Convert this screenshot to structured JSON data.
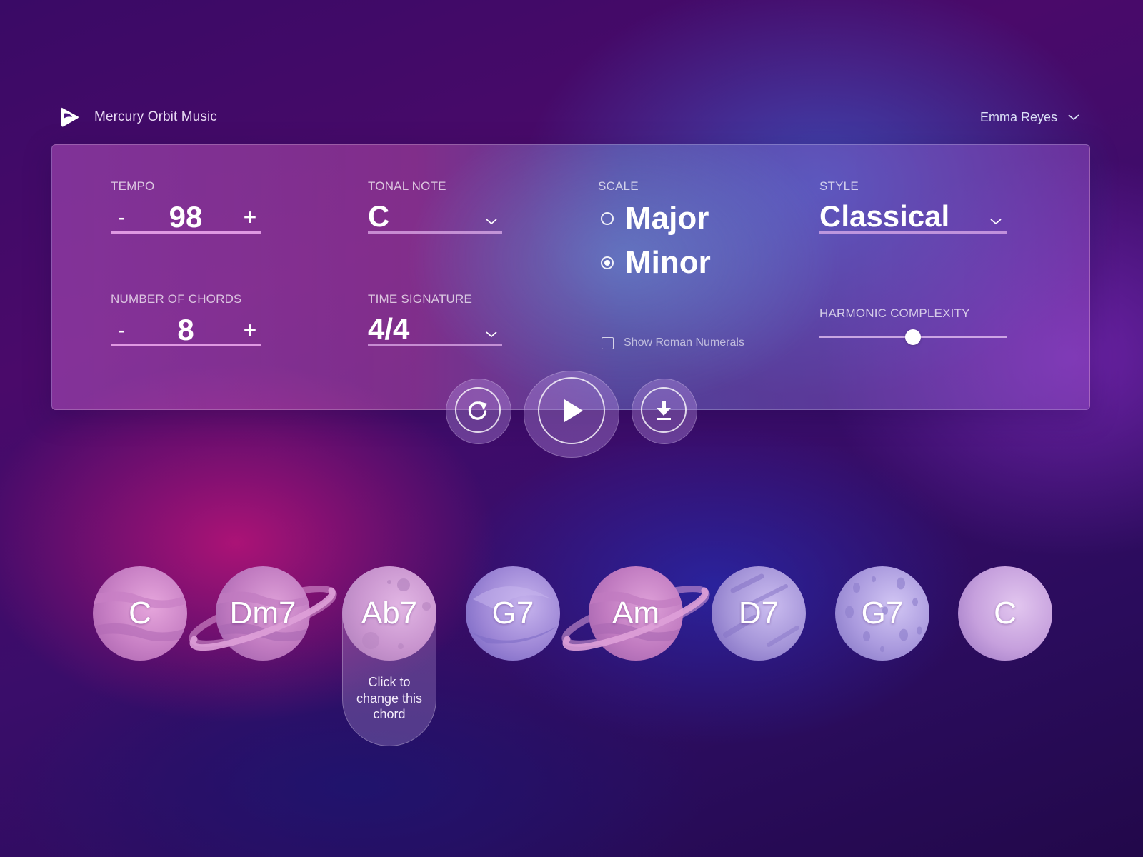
{
  "app": {
    "name": "Mercury Orbit Music",
    "logo_icon": "play-orbit-logo-icon"
  },
  "user": {
    "name": "Emma Reyes",
    "menu_icon": "chevron-down-icon"
  },
  "controls": {
    "tempo": {
      "label": "TEMPO",
      "value": "98",
      "decrement": "-",
      "increment": "+"
    },
    "chords_count": {
      "label": "NUMBER OF CHORDS",
      "value": "8",
      "decrement": "-",
      "increment": "+"
    },
    "tonal_note": {
      "label": "TONAL NOTE",
      "value": "C"
    },
    "time_signature": {
      "label": "TIME SIGNATURE",
      "value": "4/4"
    },
    "scale": {
      "label": "SCALE",
      "options": [
        {
          "label": "Major",
          "checked": false
        },
        {
          "label": "Minor",
          "checked": true
        }
      ]
    },
    "roman_numerals": {
      "label": "Show Roman Numerals",
      "checked": false
    },
    "style": {
      "label": "STYLE",
      "value": "Classical"
    },
    "harmonic_complexity": {
      "label": "HARMONIC COMPLEXITY",
      "value_fraction": 0.5
    }
  },
  "actions": {
    "regenerate_icon": "refresh-icon",
    "play_icon": "play-icon",
    "download_icon": "download-icon"
  },
  "chords": [
    {
      "label": "C",
      "planet": "banded"
    },
    {
      "label": "Dm7",
      "planet": "ringed"
    },
    {
      "label": "Ab7",
      "planet": "cratered"
    },
    {
      "label": "G7",
      "planet": "swirl"
    },
    {
      "label": "Am",
      "planet": "ringed"
    },
    {
      "label": "D7",
      "planet": "streaked"
    },
    {
      "label": "G7",
      "planet": "spotted"
    },
    {
      "label": "C",
      "planet": "plain"
    }
  ],
  "tooltip": {
    "chord_index": 2,
    "lines": [
      "Click to",
      "change this",
      "chord"
    ]
  }
}
